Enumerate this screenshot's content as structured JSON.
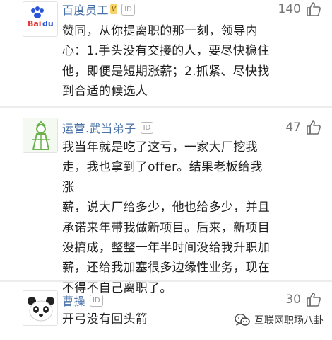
{
  "comments": [
    {
      "username": "百度员工",
      "id_tag": "ID",
      "badge": "V",
      "likes": "140",
      "avatar_icon": "baidu-logo-icon",
      "lines": [
        "赞同，从你提离职的那一刻，领导内",
        "心：1.手头没有交接的人，要尽快稳住",
        "他，即便是短期涨薪；2.抓紧、尽快找",
        "到合适的候选人"
      ]
    },
    {
      "username": "运营.武当弟子",
      "id_tag": "ID",
      "likes": "47",
      "avatar_icon": "robed-person-icon",
      "lines": [
        "我当年就是吃了这亏，一家大厂挖我",
        "走，我也拿到了offer。结果老板给我涨",
        "薪，说大厂给多少，他也给多少，并且",
        "承诺来年带我做新项目。后来，新项目",
        "没搞成，整整一年半时间没给我升职加",
        "薪，还给我加塞很多边缘性业务，现在",
        "不得不自己离职了。"
      ]
    },
    {
      "username": "曹操",
      "id_tag": "ID",
      "likes": "30",
      "avatar_icon": "panda-icon",
      "lines": [
        "开弓没有回头箭"
      ]
    }
  ],
  "watermark": {
    "text": "互联网职场八卦",
    "icon": "wechat-icon"
  },
  "colors": {
    "username": "#4a72a8",
    "body_text": "#1f1f1f",
    "like_icon": "#6f6f6f",
    "divider": "#ececec"
  }
}
